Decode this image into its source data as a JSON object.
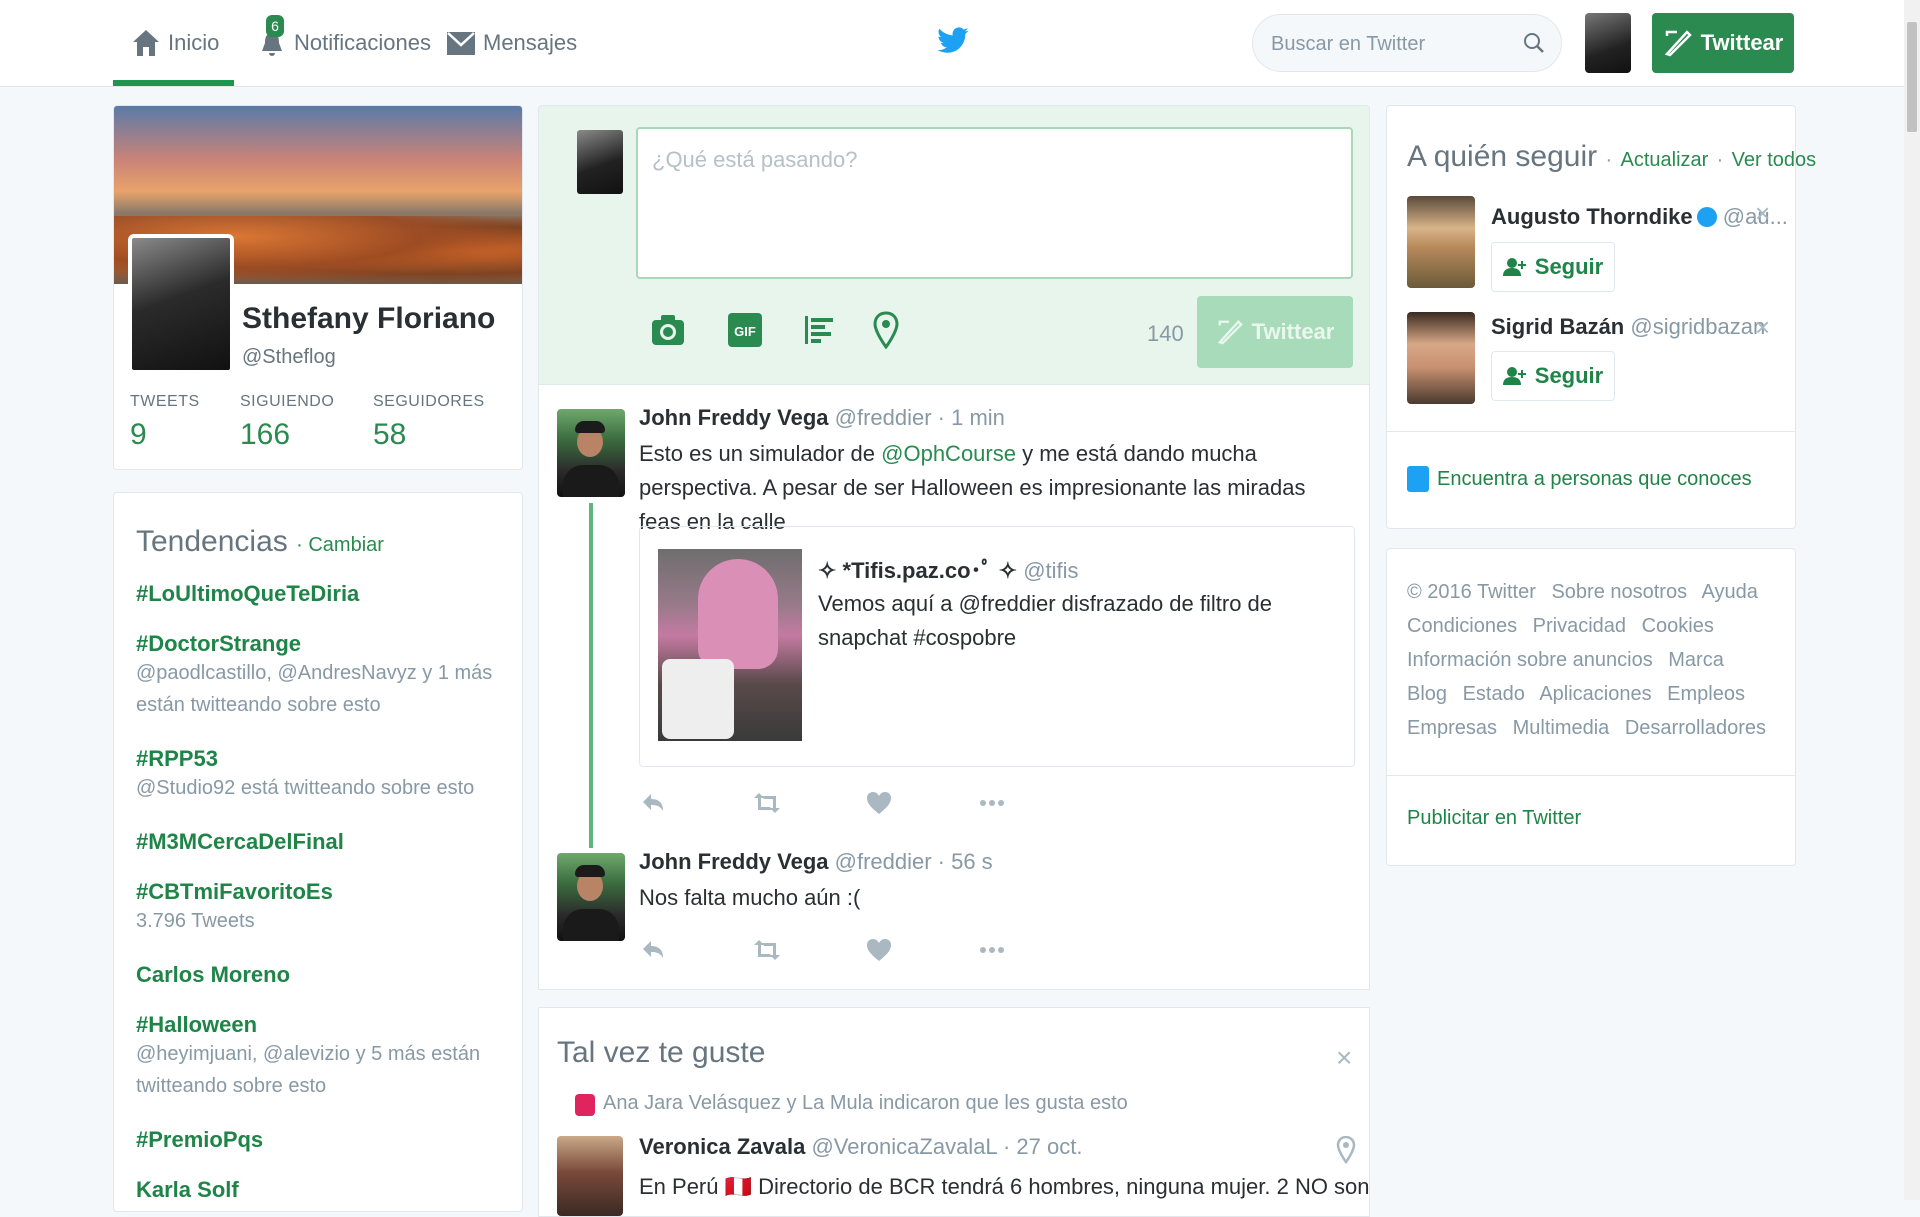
{
  "nav": {
    "home_label": "Inicio",
    "notifications_label": "Notificaciones",
    "notifications_count": "6",
    "messages_label": "Mensajes",
    "search_placeholder": "Buscar en Twitter",
    "tweet_button": "Twittear"
  },
  "profile": {
    "name": "Sthefany Floriano",
    "handle": "@Stheflog",
    "stats": [
      {
        "label": "TWEETS",
        "value": "9"
      },
      {
        "label": "SIGUIENDO",
        "value": "166"
      },
      {
        "label": "SEGUIDORES",
        "value": "58"
      }
    ]
  },
  "trends": {
    "title": "Tendencias",
    "change_link": "· Cambiar",
    "items": [
      {
        "name": "#LoUltimoQueTeDiria",
        "desc": ""
      },
      {
        "name": "#DoctorStrange",
        "desc": "@paodlcastillo, @AndresNavyz y 1 más están twitteando sobre esto"
      },
      {
        "name": "#RPP53",
        "desc": "@Studio92 está twitteando sobre esto"
      },
      {
        "name": "#M3MCercaDelFinal",
        "desc": ""
      },
      {
        "name": "#CBTmiFavoritoEs",
        "desc": "3.796 Tweets"
      },
      {
        "name": "Carlos Moreno",
        "desc": ""
      },
      {
        "name": "#Halloween",
        "desc": "@heyimjuani, @alevizio y 5 más están twitteando sobre esto"
      },
      {
        "name": "#PremioPqs",
        "desc": ""
      },
      {
        "name": "Karla Solf",
        "desc": ""
      }
    ]
  },
  "composer": {
    "placeholder": "¿Qué está pasando?",
    "char_count": "140",
    "tweet_button": "Twittear"
  },
  "tweets": [
    {
      "name": "John Freddy Vega",
      "meta": "@freddier · 1 min",
      "text_pre": "Esto es un simulador de ",
      "mention": "@OphCourse",
      "text_post": " y me está dando mucha perspectiva. A pesar de ser Halloween es impresionante las miradas feas en la calle",
      "quote": {
        "name": "✧ *Tifis.paz.co･ﾟ ✧",
        "handle": "@tifis",
        "text": "Vemos aquí a @freddier disfrazado de filtro de snapchat #cospobre"
      }
    },
    {
      "name": "John Freddy Vega",
      "meta": "@freddier · 56 s",
      "text": "Nos falta mucho aún :("
    }
  ],
  "suggest": {
    "title": "Tal vez te guste",
    "close": "×",
    "liked_by": "Ana Jara Velásquez y La Mula indicaron que les gusta esto",
    "name": "Veronica Zavala",
    "meta": "@VeronicaZavalaL · 27 oct.",
    "text": "En Perú 🇵🇪 Directorio de BCR tendrá 6 hombres, ninguna mujer. 2 NO son"
  },
  "who_to_follow": {
    "title": "A quién seguir",
    "dot": "·",
    "refresh": "Actualizar",
    "view_all": "Ver todos",
    "users": [
      {
        "name": "Augusto Thorndike",
        "handle": "@au...",
        "follow": "Seguir"
      },
      {
        "name": "Sigrid Bazán",
        "handle": "@sigridbazan",
        "follow": "Seguir"
      }
    ],
    "find_people": "Encuentra a personas que conoces"
  },
  "footer": {
    "links": [
      "© 2016 Twitter",
      "Sobre nosotros",
      "Ayuda",
      "Condiciones",
      "Privacidad",
      "Cookies",
      "Información sobre anuncios",
      "Marca",
      "Blog",
      "Estado",
      "Aplicaciones",
      "Empleos",
      "Empresas",
      "Multimedia",
      "Desarrolladores"
    ],
    "advertise": "Publicitar en Twitter"
  },
  "colors": {
    "accent": "#2a8a4f",
    "accent_light": "#a8dbb9",
    "bird": "#1da1f2"
  }
}
